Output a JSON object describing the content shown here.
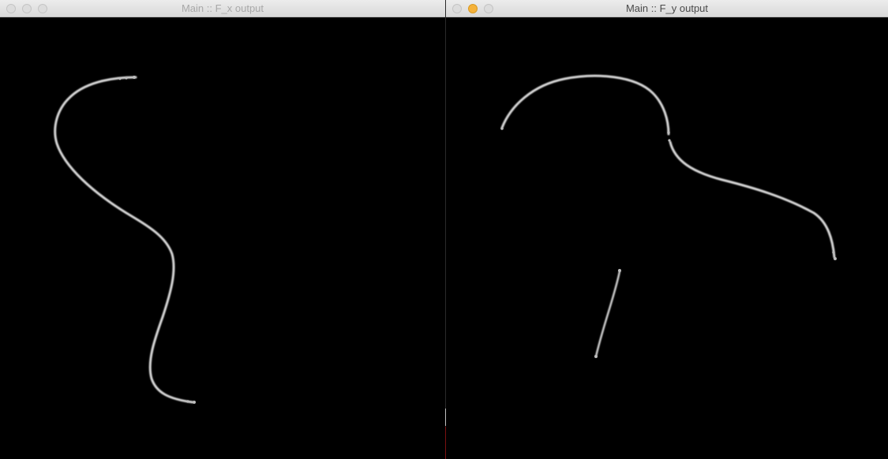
{
  "windows": [
    {
      "title": "Main :: F_x output",
      "focused": false
    },
    {
      "title": "Main :: F_y output",
      "focused": true
    }
  ],
  "colors": {
    "canvas_background": "#000000",
    "stroke": "#d8d8d8",
    "minimize_active": "#f5b23a",
    "titlebar": "#e4e4e4"
  },
  "icons": {
    "close": "close-icon",
    "minimize": "minimize-icon",
    "zoom": "zoom-icon"
  }
}
